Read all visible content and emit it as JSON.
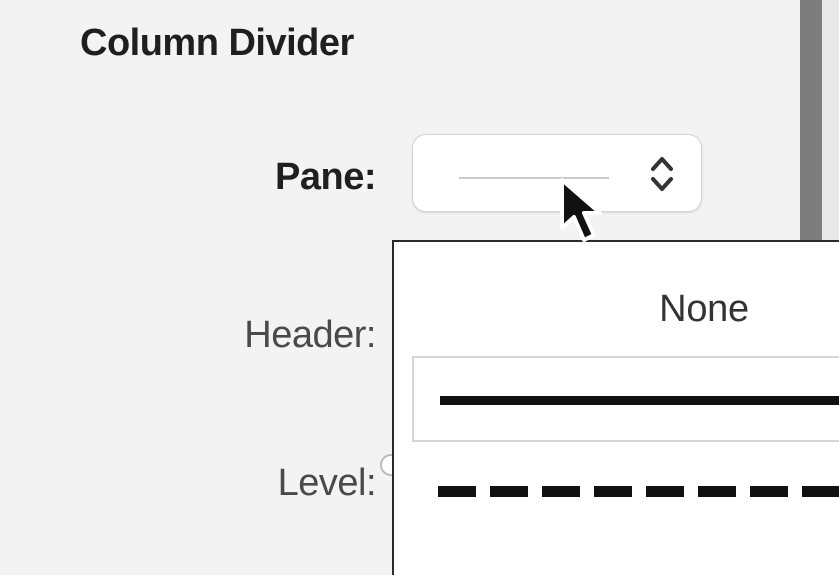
{
  "section": {
    "title": "Column Divider"
  },
  "rows": {
    "pane_label": "Pane:",
    "header_label": "Header:",
    "level_label": "Level:"
  },
  "popup": {
    "icon": "up-down-chevron-icon"
  },
  "menu": {
    "none_label": "None",
    "items": [
      "solid-line",
      "dashed-line"
    ],
    "selected_index": 0
  },
  "cursor": {
    "icon": "arrow-cursor-icon"
  }
}
